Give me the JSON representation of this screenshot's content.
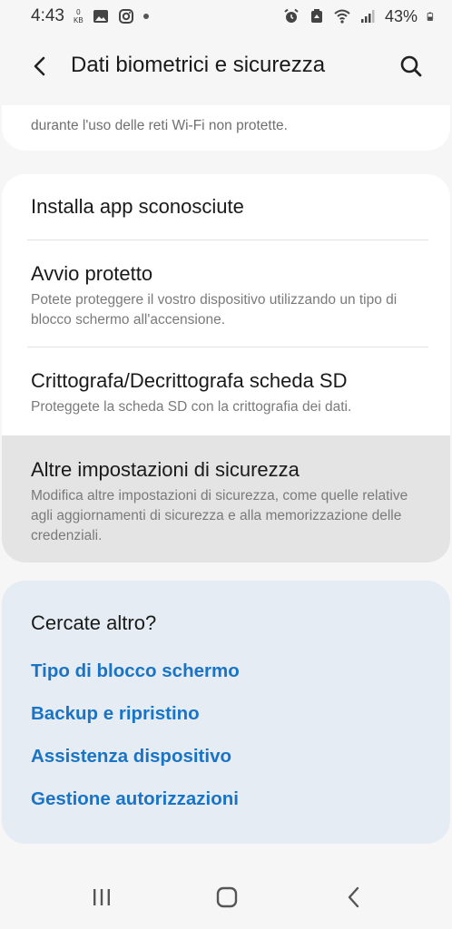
{
  "status_bar": {
    "time": "4:43",
    "kb_value": "0",
    "kb_unit": "KB",
    "battery": "43%"
  },
  "header": {
    "title": "Dati biometrici e sicurezza"
  },
  "top_card": {
    "partial_text": "durante l'uso delle reti Wi-Fi non protette."
  },
  "settings": [
    {
      "title": "Installa app sconosciute",
      "subtitle": ""
    },
    {
      "title": "Avvio protetto",
      "subtitle": "Potete proteggere il vostro dispositivo utilizzando un tipo di blocco schermo all'accensione."
    },
    {
      "title": "Crittografa/Decrittografa scheda SD",
      "subtitle": "Proteggete la scheda SD con la crittografia dei dati."
    },
    {
      "title": "Altre impostazioni di sicurezza",
      "subtitle": "Modifica altre impostazioni di sicurezza, come quelle relative agli aggiornamenti di sicurezza e alla memorizzazione delle credenziali."
    }
  ],
  "more": {
    "title": "Cercate altro?",
    "links": [
      "Tipo di blocco schermo",
      "Backup e ripristino",
      "Assistenza dispositivo",
      "Gestione autorizzazioni"
    ]
  },
  "colors": {
    "background": "#f6f6f6",
    "card": "#ffffff",
    "highlight": "#e4e4e4",
    "more_card": "#e5ecf3",
    "link": "#1a74c6"
  },
  "icons": {
    "status": [
      "gallery-icon",
      "instagram-icon",
      "alarm-icon",
      "data-saver-icon",
      "wifi-icon",
      "signal-icon",
      "battery-icon"
    ],
    "header": [
      "back-arrow-icon",
      "search-icon"
    ],
    "nav": [
      "recents-icon",
      "home-icon",
      "back-icon"
    ]
  }
}
